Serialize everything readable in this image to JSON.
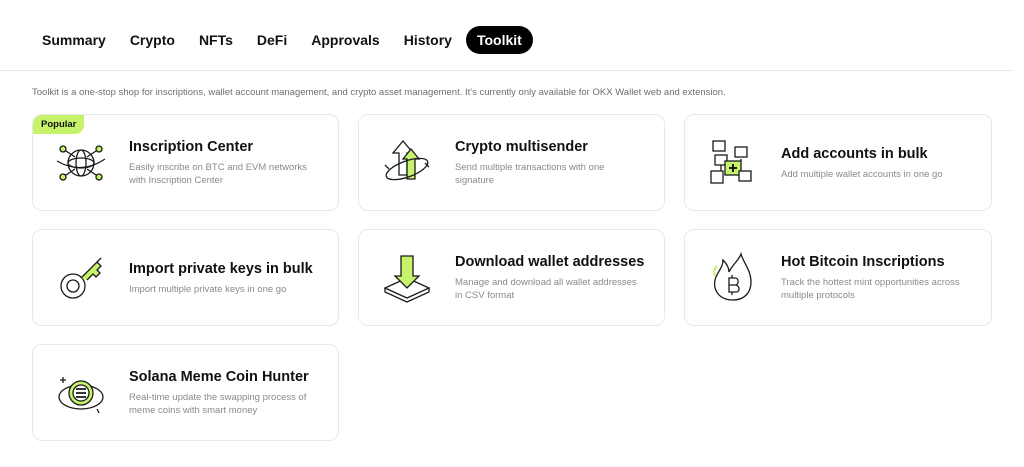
{
  "tabs": [
    {
      "label": "Summary"
    },
    {
      "label": "Crypto"
    },
    {
      "label": "NFTs"
    },
    {
      "label": "DeFi"
    },
    {
      "label": "Approvals"
    },
    {
      "label": "History"
    },
    {
      "label": "Toolkit",
      "active": true
    }
  ],
  "description": "Toolkit is a one-stop shop for inscriptions, wallet account management, and crypto asset management. It's currently only available for OKX Wallet web and extension.",
  "cards": [
    {
      "title": "Inscription Center",
      "subtitle": "Easily inscribe on BTC and EVM networks with Inscription Center",
      "badge": "Popular",
      "icon": "inscription-globe-icon"
    },
    {
      "title": "Crypto multisender",
      "subtitle": "Send multiple transactions with one signature",
      "icon": "multisender-arrows-icon"
    },
    {
      "title": "Add accounts in bulk",
      "subtitle": "Add multiple wallet accounts in one go",
      "icon": "add-accounts-icon"
    },
    {
      "title": "Import private keys in bulk",
      "subtitle": "Import multiple private keys in one go",
      "icon": "key-icon"
    },
    {
      "title": "Download wallet addresses",
      "subtitle": "Manage and download all wallet addresses in CSV format",
      "icon": "download-icon"
    },
    {
      "title": "Hot Bitcoin Inscriptions",
      "subtitle": "Track the hottest mint opportunities across multiple protocols",
      "icon": "bitcoin-flame-icon"
    },
    {
      "title": "Solana Meme Coin Hunter",
      "subtitle": "Real-time update the swapping process of meme coins with smart money",
      "icon": "solana-coin-icon"
    }
  ],
  "colors": {
    "accent": "#c6f36b",
    "active_tab_bg": "#000000",
    "border": "#e8e8e8"
  }
}
